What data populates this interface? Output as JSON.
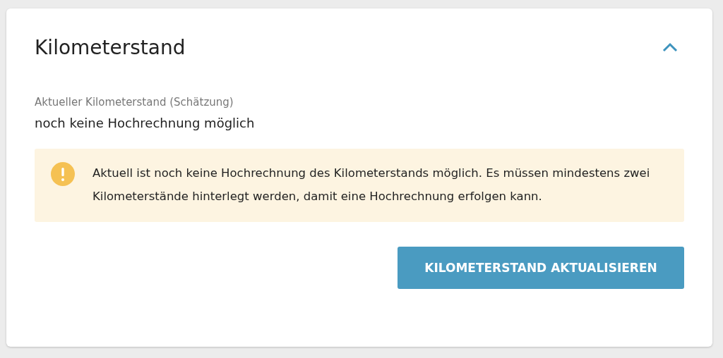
{
  "panel": {
    "title": "Kilometerstand",
    "expanded": true
  },
  "field": {
    "label": "Aktueller Kilometerstand (Schätzung)",
    "value": "noch keine Hochrechnung möglich"
  },
  "alert": {
    "kind": "warning",
    "text": "Aktuell ist noch keine Hochrechnung des Kilometerstands möglich. Es müssen mindestens zwei Kilometerstände hinterlegt werden, damit eine Hochrechnung erfolgen kann."
  },
  "button": {
    "label": "KILOMETERSTAND AKTUALISIEREN"
  }
}
